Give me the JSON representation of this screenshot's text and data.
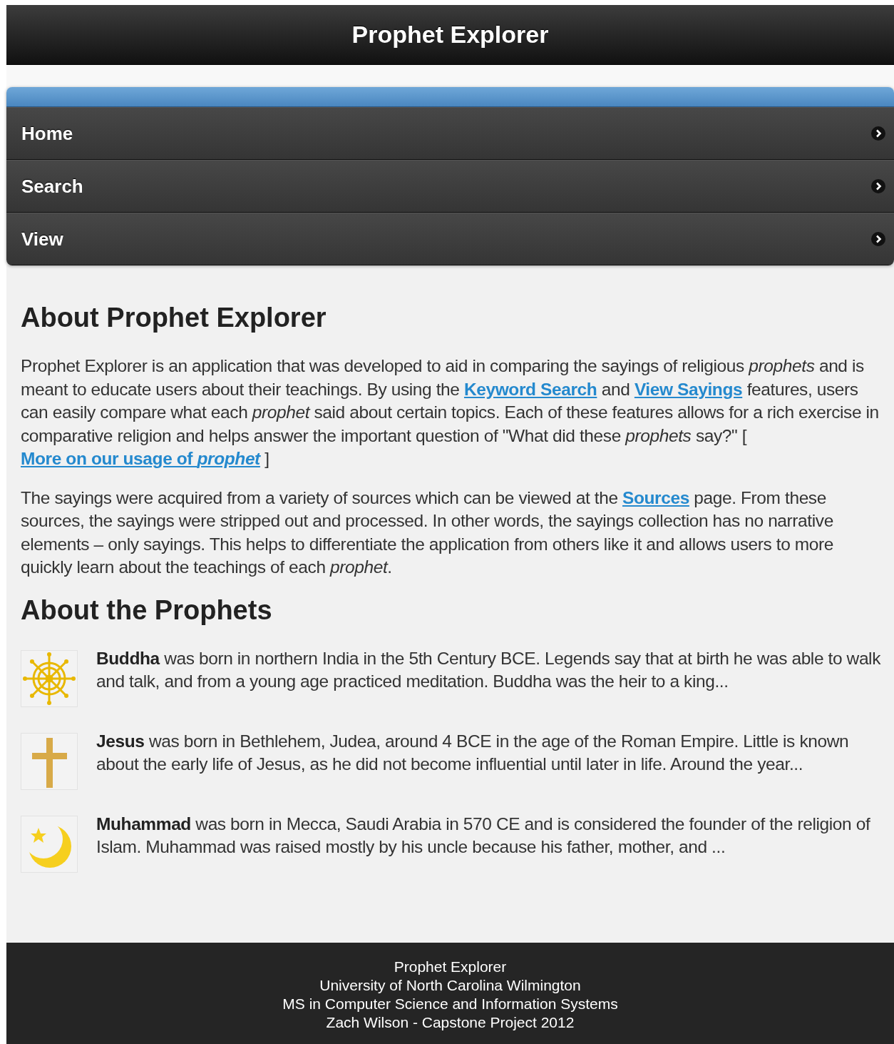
{
  "header": {
    "title": "Prophet Explorer"
  },
  "nav": {
    "items": [
      {
        "label": "Home"
      },
      {
        "label": "Search"
      },
      {
        "label": "View"
      }
    ]
  },
  "about": {
    "heading": "About Prophet Explorer",
    "paragraphs": [
      [
        {
          "kind": "text",
          "text": "Prophet Explorer is an application that was developed to aid in comparing the sayings of religious *prophets* and is meant to educate users about their teachings. By using the "
        },
        {
          "kind": "link",
          "text": "Keyword Search"
        },
        {
          "kind": "text",
          "text": " and "
        },
        {
          "kind": "link",
          "text": "View Sayings"
        },
        {
          "kind": "text",
          "text": " features, users can easily compare what each *prophet* said about certain topics. Each of these features allows for a rich exercise in comparative religion and helps answer the important question of \"What did these *prophets* say?\" [ "
        },
        {
          "kind": "link",
          "text": "More on our usage of *prophet*"
        },
        {
          "kind": "text",
          "text": " ]"
        }
      ],
      [
        {
          "kind": "text",
          "text": "The sayings were acquired from a variety of sources which can be viewed at the "
        },
        {
          "kind": "link",
          "text": "Sources"
        },
        {
          "kind": "text",
          "text": " page. From these sources, the sayings were stripped out and processed. In other words, the sayings collection has no narrative elements – only sayings. This helps to differentiate the application from others like it and allows users to more quickly learn about the teachings of each *prophet*."
        }
      ]
    ]
  },
  "prophets": {
    "heading": "About the Prophets",
    "items": [
      {
        "kind": "wheel",
        "text": "**Buddha** was born in northern India in the 5th Century BCE. Legends say that at birth he was able to walk and talk, and from a young age practiced meditation. Buddha was the heir to a king..."
      },
      {
        "kind": "cross",
        "text": "**Jesus** was born in Bethlehem, Judea, around 4 BCE in the age of the Roman Empire. Little is known about the early life of Jesus, as he did not become influential until later in life. Around the year..."
      },
      {
        "kind": "crescent",
        "text": "**Muhammad** was born in Mecca, Saudi Arabia in 570 CE and is considered the founder of the religion of Islam. Muhammad was raised mostly by his uncle because his father, mother, and ..."
      }
    ]
  },
  "footer": {
    "lines": [
      "Prophet Explorer",
      "University of North Carolina Wilmington",
      "MS in Computer Science and Information Systems",
      "Zach Wilson - Capstone Project 2012"
    ]
  }
}
